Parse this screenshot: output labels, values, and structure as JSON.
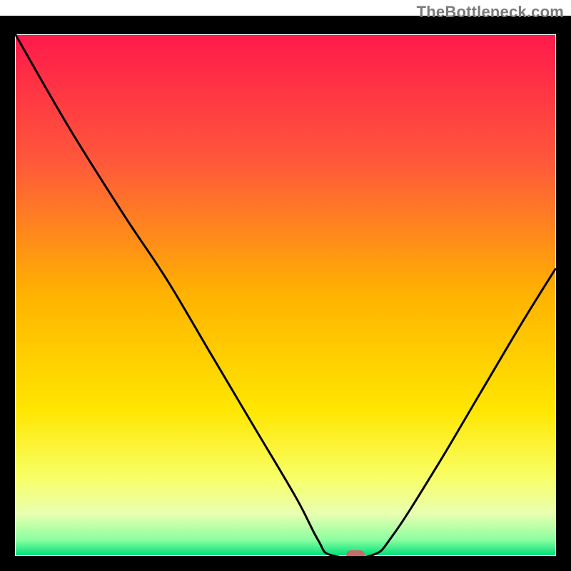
{
  "attribution": "TheBottleneck.com",
  "chart_data": {
    "type": "line",
    "title": "",
    "xlabel": "",
    "ylabel": "",
    "xlim": [
      0,
      100
    ],
    "ylim": [
      0,
      100
    ],
    "background_gradient_stops": [
      {
        "offset": 0.0,
        "color": "#ff1a4b"
      },
      {
        "offset": 0.25,
        "color": "#ff5a3a"
      },
      {
        "offset": 0.5,
        "color": "#ffb300"
      },
      {
        "offset": 0.72,
        "color": "#ffe600"
      },
      {
        "offset": 0.85,
        "color": "#f8ff66"
      },
      {
        "offset": 0.92,
        "color": "#e9ffb0"
      },
      {
        "offset": 0.97,
        "color": "#8cffa0"
      },
      {
        "offset": 1.0,
        "color": "#00e07a"
      }
    ],
    "curve_points": [
      {
        "x": 0.0,
        "y": 100.0
      },
      {
        "x": 10.0,
        "y": 82.0
      },
      {
        "x": 20.0,
        "y": 65.5
      },
      {
        "x": 28.0,
        "y": 53.0
      },
      {
        "x": 36.0,
        "y": 39.0
      },
      {
        "x": 44.0,
        "y": 25.0
      },
      {
        "x": 52.0,
        "y": 11.0
      },
      {
        "x": 56.0,
        "y": 3.0
      },
      {
        "x": 58.5,
        "y": 0.0
      },
      {
        "x": 66.0,
        "y": 0.0
      },
      {
        "x": 70.0,
        "y": 4.0
      },
      {
        "x": 78.0,
        "y": 17.0
      },
      {
        "x": 86.0,
        "y": 31.0
      },
      {
        "x": 94.0,
        "y": 45.0
      },
      {
        "x": 100.0,
        "y": 55.0
      }
    ],
    "marker": {
      "x": 63.0,
      "y": 0.0,
      "color": "#c76b6b"
    },
    "frame_color": "#000000",
    "curve_color": "#000000"
  }
}
